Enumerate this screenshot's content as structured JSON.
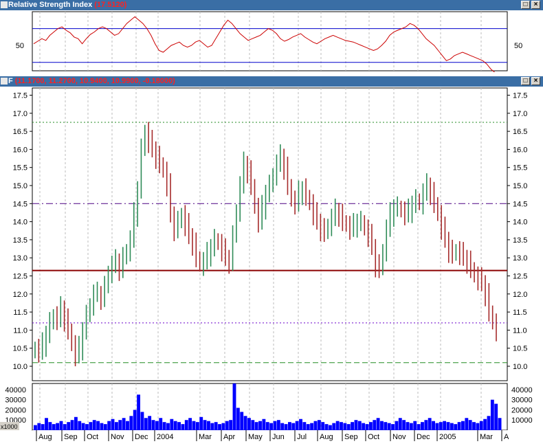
{
  "rsi_window": {
    "title": "Relative Strength Index",
    "value": "(17.5120)",
    "buttons": [
      "□",
      "×"
    ]
  },
  "price_window": {
    "title": "F",
    "value": "(11.1700, 11.2700, 10.9400, 10.9900, -0.18000)",
    "buttons": [
      "□",
      "×"
    ]
  },
  "colors": {
    "titlebar": "#3a6ea5",
    "rsi_line": "#cc0000",
    "rsi_bands": "#0000cc",
    "candle_up": "#2e8b57",
    "candle_down": "#a52a2a",
    "volume": "#0000ff",
    "support_line": "#8b0000",
    "resistance_line": "#4b0082",
    "lower_purple_line": "#6a00cc",
    "green_dashed_line": "#228b22"
  },
  "chart_data": [
    {
      "type": "line",
      "name": "RSI pane",
      "yticks": [
        "50"
      ],
      "ylim": [
        20,
        90
      ],
      "bands": [
        70,
        30
      ],
      "values": [
        52,
        55,
        58,
        56,
        62,
        66,
        70,
        72,
        68,
        65,
        60,
        58,
        52,
        58,
        63,
        66,
        70,
        72,
        70,
        66,
        62,
        64,
        70,
        76,
        80,
        84,
        80,
        76,
        70,
        62,
        52,
        44,
        42,
        46,
        50,
        52,
        54,
        50,
        48,
        50,
        54,
        56,
        52,
        48,
        50,
        58,
        66,
        74,
        80,
        76,
        70,
        64,
        60,
        56,
        58,
        60,
        62,
        66,
        70,
        68,
        64,
        58,
        55,
        57,
        60,
        62,
        64,
        60,
        57,
        54,
        52,
        55,
        58,
        60,
        62,
        60,
        58,
        56,
        55,
        54,
        52,
        50,
        48,
        46,
        44,
        46,
        50,
        55,
        62,
        66,
        68,
        70,
        72,
        76,
        74,
        70,
        64,
        58,
        54,
        50,
        44,
        38,
        32,
        34,
        38,
        40,
        42,
        40,
        38,
        36,
        34,
        32,
        28,
        22,
        18
      ],
      "xlabels": [
        "Aug",
        "Sep",
        "Oct",
        "Nov",
        "Dec",
        "2004",
        "Mar",
        "Apr",
        "May",
        "Jun",
        "Jul",
        "Aug",
        "Sep",
        "Oct",
        "Nov",
        "Dec",
        "2005",
        "Mar"
      ]
    },
    {
      "type": "candlestick",
      "name": "Price pane",
      "yticks": [
        "17.5",
        "17.0",
        "16.5",
        "16.0",
        "15.5",
        "15.0",
        "14.5",
        "14.0",
        "13.5",
        "13.0",
        "12.5",
        "12.0",
        "11.5",
        "11.0",
        "10.5",
        "10.0"
      ],
      "ylim": [
        9.6,
        17.7
      ],
      "closes": [
        10.5,
        10.4,
        10.6,
        10.9,
        11.2,
        11.4,
        11.3,
        11.6,
        11.3,
        11.0,
        10.6,
        10.3,
        10.5,
        11.0,
        11.4,
        11.7,
        12.0,
        12.0,
        11.9,
        12.2,
        12.6,
        12.8,
        12.9,
        12.7,
        13.0,
        13.2,
        13.5,
        14.2,
        14.9,
        16.0,
        16.5,
        16.2,
        16.0,
        15.8,
        15.6,
        15.4,
        15.0,
        14.2,
        13.8,
        14.0,
        14.2,
        13.9,
        13.6,
        13.4,
        13.0,
        12.8,
        12.9,
        13.1,
        13.3,
        13.5,
        13.4,
        13.2,
        13.0,
        12.9,
        13.6,
        14.3,
        15.0,
        15.6,
        15.4,
        15.0,
        14.4,
        14.0,
        14.4,
        14.8,
        15.0,
        15.3,
        15.6,
        15.8,
        15.5,
        15.0,
        14.6,
        14.5,
        14.8,
        14.9,
        14.7,
        14.5,
        14.2,
        14.0,
        13.8,
        13.7,
        13.9,
        14.1,
        14.3,
        14.2,
        14.0,
        13.9,
        13.8,
        13.9,
        14.0,
        14.0,
        13.8,
        13.6,
        13.3,
        12.8,
        12.7,
        13.2,
        13.8,
        14.2,
        14.4,
        14.4,
        14.3,
        14.2,
        14.3,
        14.5,
        14.6,
        14.5,
        14.8,
        15.0,
        14.8,
        14.5,
        14.2,
        13.8,
        13.5,
        13.2,
        13.1,
        13.2,
        13.1,
        13.0,
        12.9,
        12.7,
        12.5,
        12.4,
        12.3,
        12.0,
        11.5,
        11.2,
        10.99
      ],
      "hlines": [
        {
          "value": 12.65,
          "style": "solid",
          "colorKey": "support_line"
        },
        {
          "value": 14.5,
          "style": "dashdot",
          "colorKey": "resistance_line"
        },
        {
          "value": 11.2,
          "style": "dotted",
          "colorKey": "lower_purple_line"
        },
        {
          "value": 10.1,
          "style": "dashed",
          "colorKey": "green_dashed_line"
        },
        {
          "value": 16.75,
          "style": "dotted",
          "colorKey": "green_dashed_line"
        }
      ]
    },
    {
      "type": "bar",
      "name": "Volume pane",
      "yticks": [
        "40000",
        "30000",
        "20000",
        "10000"
      ],
      "unit_label": "x1000",
      "ylim": [
        0,
        46000
      ],
      "values": [
        5000,
        7000,
        6000,
        12000,
        8000,
        6000,
        7000,
        9000,
        6000,
        8000,
        10000,
        13000,
        9000,
        7000,
        6000,
        8000,
        10000,
        9000,
        7000,
        6000,
        9000,
        11000,
        8000,
        10000,
        12000,
        9000,
        14000,
        20000,
        35000,
        18000,
        12000,
        14000,
        10000,
        9000,
        12000,
        8000,
        7000,
        11000,
        9000,
        8000,
        6000,
        10000,
        12000,
        9000,
        8000,
        13000,
        10000,
        9000,
        7000,
        8000,
        6000,
        7000,
        9000,
        10000,
        46000,
        22000,
        18000,
        14000,
        12000,
        10000,
        8000,
        9000,
        11000,
        8000,
        7000,
        9000,
        10000,
        7000,
        6000,
        8000,
        7000,
        9000,
        11000,
        8000,
        6000,
        7000,
        9000,
        10000,
        8000,
        6000,
        5000,
        7000,
        9000,
        8000,
        7000,
        6000,
        8000,
        10000,
        9000,
        7000,
        6000,
        8000,
        10000,
        12000,
        9000,
        8000,
        7000,
        6000,
        9000,
        12000,
        10000,
        8000,
        7000,
        9000,
        6000,
        8000,
        10000,
        12000,
        9000,
        7000,
        8000,
        9000,
        8000,
        7000,
        6000,
        8000,
        9000,
        12000,
        10000,
        8000,
        7000,
        9000,
        11000,
        14000,
        30000,
        26000,
        12000
      ],
      "xlabels": [
        "Aug",
        "Sep",
        "Oct",
        "Nov",
        "Dec",
        "2004",
        "Mar",
        "Apr",
        "May",
        "Jun",
        "Jul",
        "Aug",
        "Sep",
        "Oct",
        "Nov",
        "Dec",
        "2005",
        "Mar",
        "A"
      ]
    }
  ]
}
